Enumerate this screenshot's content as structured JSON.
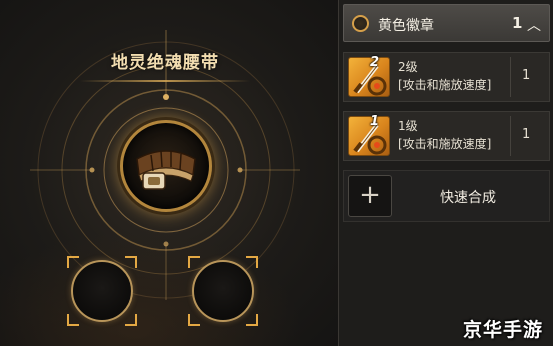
{
  "scene": {
    "item_name": "地灵绝魂腰带"
  },
  "panel": {
    "header": {
      "title": "黄色徽章",
      "count": "1",
      "chevron_icon": "chevron-up-icon"
    },
    "rows": [
      {
        "level_badge": "2",
        "level_text": "2级",
        "desc": "[攻击和施放速度]",
        "qty": "1",
        "icon": "sword-gem-icon"
      },
      {
        "level_badge": "1",
        "level_text": "1级",
        "desc": "[攻击和施放速度]",
        "qty": "1",
        "icon": "sword-gem-icon"
      }
    ],
    "synth": {
      "plus": "+",
      "label": "快速合成"
    }
  },
  "watermark": "京华手游",
  "colors": {
    "gold": "#d6a04a",
    "title_gold": "#f2ddb0",
    "panel_bg": "#1e1d1b"
  }
}
